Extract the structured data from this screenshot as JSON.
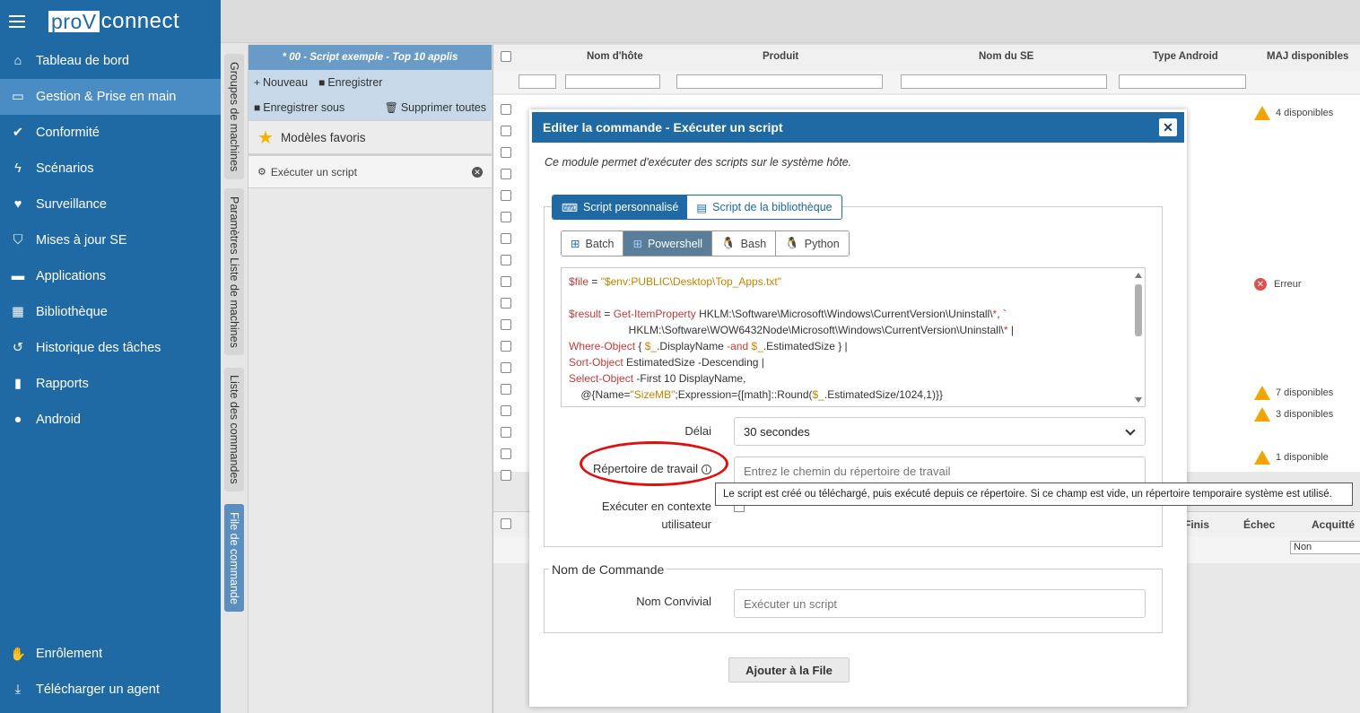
{
  "app": {
    "logo_box": "proV",
    "logo_text": "connect"
  },
  "nav": [
    {
      "label": "Tableau de bord",
      "icon": "home-icon"
    },
    {
      "label": "Gestion & Prise en main",
      "icon": "monitor-icon",
      "active": true
    },
    {
      "label": "Conformité",
      "icon": "check-icon"
    },
    {
      "label": "Scénarios",
      "icon": "bolt-icon"
    },
    {
      "label": "Surveillance",
      "icon": "heartbeat-icon"
    },
    {
      "label": "Mises à jour SE",
      "icon": "shield-icon"
    },
    {
      "label": "Applications",
      "icon": "briefcase-icon"
    },
    {
      "label": "Bibliothèque",
      "icon": "library-icon"
    },
    {
      "label": "Historique des tâches",
      "icon": "history-icon"
    },
    {
      "label": "Rapports",
      "icon": "chart-icon"
    },
    {
      "label": "Android",
      "icon": "android-icon"
    }
  ],
  "nav_bottom": [
    {
      "label": "Enrôlement",
      "icon": "handshake-icon"
    },
    {
      "label": "Télécharger un agent",
      "icon": "download-icon"
    }
  ],
  "vtabs": [
    {
      "label": "Groupes de machines"
    },
    {
      "label": "Paramètres Liste de machines"
    },
    {
      "label": "Liste des commandes"
    },
    {
      "label": "File de commande",
      "active": true
    }
  ],
  "left_panel": {
    "header": "* 00 - Script exemple - Top 10 applis",
    "toolbar": {
      "new": "Nouveau",
      "save": "Enregistrer",
      "save_as": "Enregistrer sous",
      "delete_all": "Supprimer toutes"
    },
    "favorites": "Modèles favoris",
    "command_item": "Exécuter un script"
  },
  "table": {
    "columns": [
      "Nom d'hôte",
      "Produit",
      "Nom du SE",
      "Type Android",
      "MAJ disponibles"
    ],
    "updates": [
      {
        "text": "4 disponibles",
        "type": "warn"
      },
      {
        "text": "Erreur",
        "type": "error"
      },
      {
        "text": "7 disponibles",
        "type": "warn"
      },
      {
        "text": "3 disponibles",
        "type": "warn"
      },
      {
        "text": "1 disponible",
        "type": "warn"
      }
    ],
    "lower_columns": [
      "Finis",
      "Échec",
      "Acquitté"
    ],
    "lower_filter_value": "Non"
  },
  "modal": {
    "title": "Editer la commande - Exécuter un script",
    "description": "Ce module permet d'exécuter des scripts sur le système hôte.",
    "script_tabs": [
      "Script personnalisé",
      "Script de la bibliothèque"
    ],
    "languages": [
      "Batch",
      "Powershell",
      "Bash",
      "Python"
    ],
    "active_language": "Powershell",
    "code_lines": [
      [
        [
          "$file",
          "kw"
        ],
        [
          " = ",
          "plain"
        ],
        [
          "\"$env:PUBLIC\\Desktop\\Top_Apps.txt\"",
          "str"
        ]
      ],
      [],
      [
        [
          "$result",
          "kw"
        ],
        [
          " = ",
          "plain"
        ],
        [
          "Get-ItemProperty",
          "kw"
        ],
        [
          " HKLM:\\Software\\Microsoft\\Windows\\CurrentVersion\\Uninstall\\",
          "plain"
        ],
        [
          "*",
          "kw"
        ],
        [
          ", `",
          "plain"
        ]
      ],
      [
        [
          "                    HKLM:\\Software\\WOW6432Node\\Microsoft\\Windows\\CurrentVersion\\Uninstall\\",
          "plain"
        ],
        [
          "*",
          "kw"
        ],
        [
          " |",
          "plain"
        ]
      ],
      [
        [
          "Where-Object",
          "kw"
        ],
        [
          " { ",
          "plain"
        ],
        [
          "$_",
          "str"
        ],
        [
          ".DisplayName ",
          "plain"
        ],
        [
          "-and",
          "kw"
        ],
        [
          " ",
          "plain"
        ],
        [
          "$_",
          "str"
        ],
        [
          ".EstimatedSize } |",
          "plain"
        ]
      ],
      [
        [
          "Sort-Object",
          "kw"
        ],
        [
          " EstimatedSize -Descending |",
          "plain"
        ]
      ],
      [
        [
          "Select-Object",
          "kw"
        ],
        [
          " -First 10 DisplayName,",
          "plain"
        ]
      ],
      [
        [
          "    @{Name=",
          "plain"
        ],
        [
          "\"SizeMB\"",
          "str"
        ],
        [
          ";Expression={[math]::Round(",
          "plain"
        ],
        [
          "$_",
          "str"
        ],
        [
          ".EstimatedSize/1024,1)}}",
          "plain"
        ]
      ]
    ],
    "delay_label": "Délai",
    "delay_value": "30 secondes",
    "workdir_label": "Répertoire de travail",
    "workdir_placeholder": "Entrez le chemin du répertoire de travail",
    "tooltip": "Le script est créé ou téléchargé, puis exécuté depuis ce répertoire. Si ce champ est vide, un répertoire temporaire système est utilisé.",
    "user_context_label_1": "Exécuter en contexte",
    "user_context_label_2": "utilisateur",
    "command_name_legend": "Nom de Commande",
    "friendly_name_label": "Nom Convivial",
    "friendly_name_placeholder": "Exécuter un script",
    "add_button": "Ajouter à la File"
  },
  "colors": {
    "primary": "#1f6aa5",
    "active_nav": "#4a8cc4",
    "warn": "#f0a500",
    "error": "#d9534f",
    "highlight": "#e01010"
  }
}
